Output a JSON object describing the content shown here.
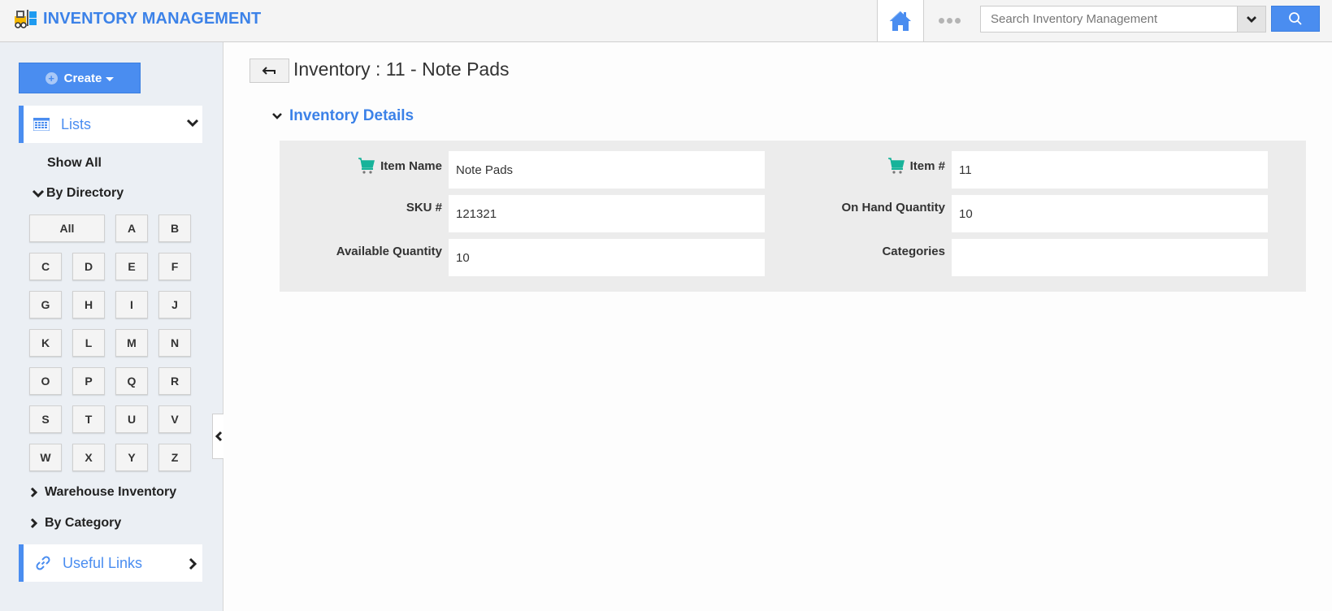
{
  "header": {
    "app_title": "INVENTORY MANAGEMENT",
    "brand_icon": "forklift-icon",
    "home_icon": "home-icon",
    "more_icon": "more-dots-icon",
    "search": {
      "placeholder": "Search Inventory Management",
      "value": "",
      "dropdown_icon": "chevron-down-icon",
      "button_icon": "search-icon"
    }
  },
  "sidebar": {
    "create_label": "Create",
    "lists_label": "Lists",
    "show_all_label": "Show All",
    "by_directory_label": "By Directory",
    "directory_letters": [
      "All",
      "A",
      "B",
      "C",
      "D",
      "E",
      "F",
      "G",
      "H",
      "I",
      "J",
      "K",
      "L",
      "M",
      "N",
      "O",
      "P",
      "Q",
      "R",
      "S",
      "T",
      "U",
      "V",
      "W",
      "X",
      "Y",
      "Z"
    ],
    "warehouse_inventory_label": "Warehouse Inventory",
    "by_category_label": "By Category",
    "useful_links_label": "Useful Links"
  },
  "main": {
    "page_title": "Inventory : 11 - Note Pads",
    "section_title": "Inventory Details",
    "fields": {
      "item_name": {
        "label": "Item Name",
        "value": "Note Pads"
      },
      "item_number": {
        "label": "Item #",
        "value": "11"
      },
      "sku": {
        "label": "SKU #",
        "value": "121321"
      },
      "on_hand_quantity": {
        "label": "On Hand Quantity",
        "value": "10"
      },
      "available_quantity": {
        "label": "Available Quantity",
        "value": "10"
      },
      "categories": {
        "label": "Categories",
        "value": ""
      }
    }
  },
  "colors": {
    "accent": "#4a8df0",
    "brand_text": "#3c82e8",
    "cart_icon": "#17b39a",
    "sidebar_bg": "#ebeff4",
    "panel_bg": "#ececec"
  }
}
